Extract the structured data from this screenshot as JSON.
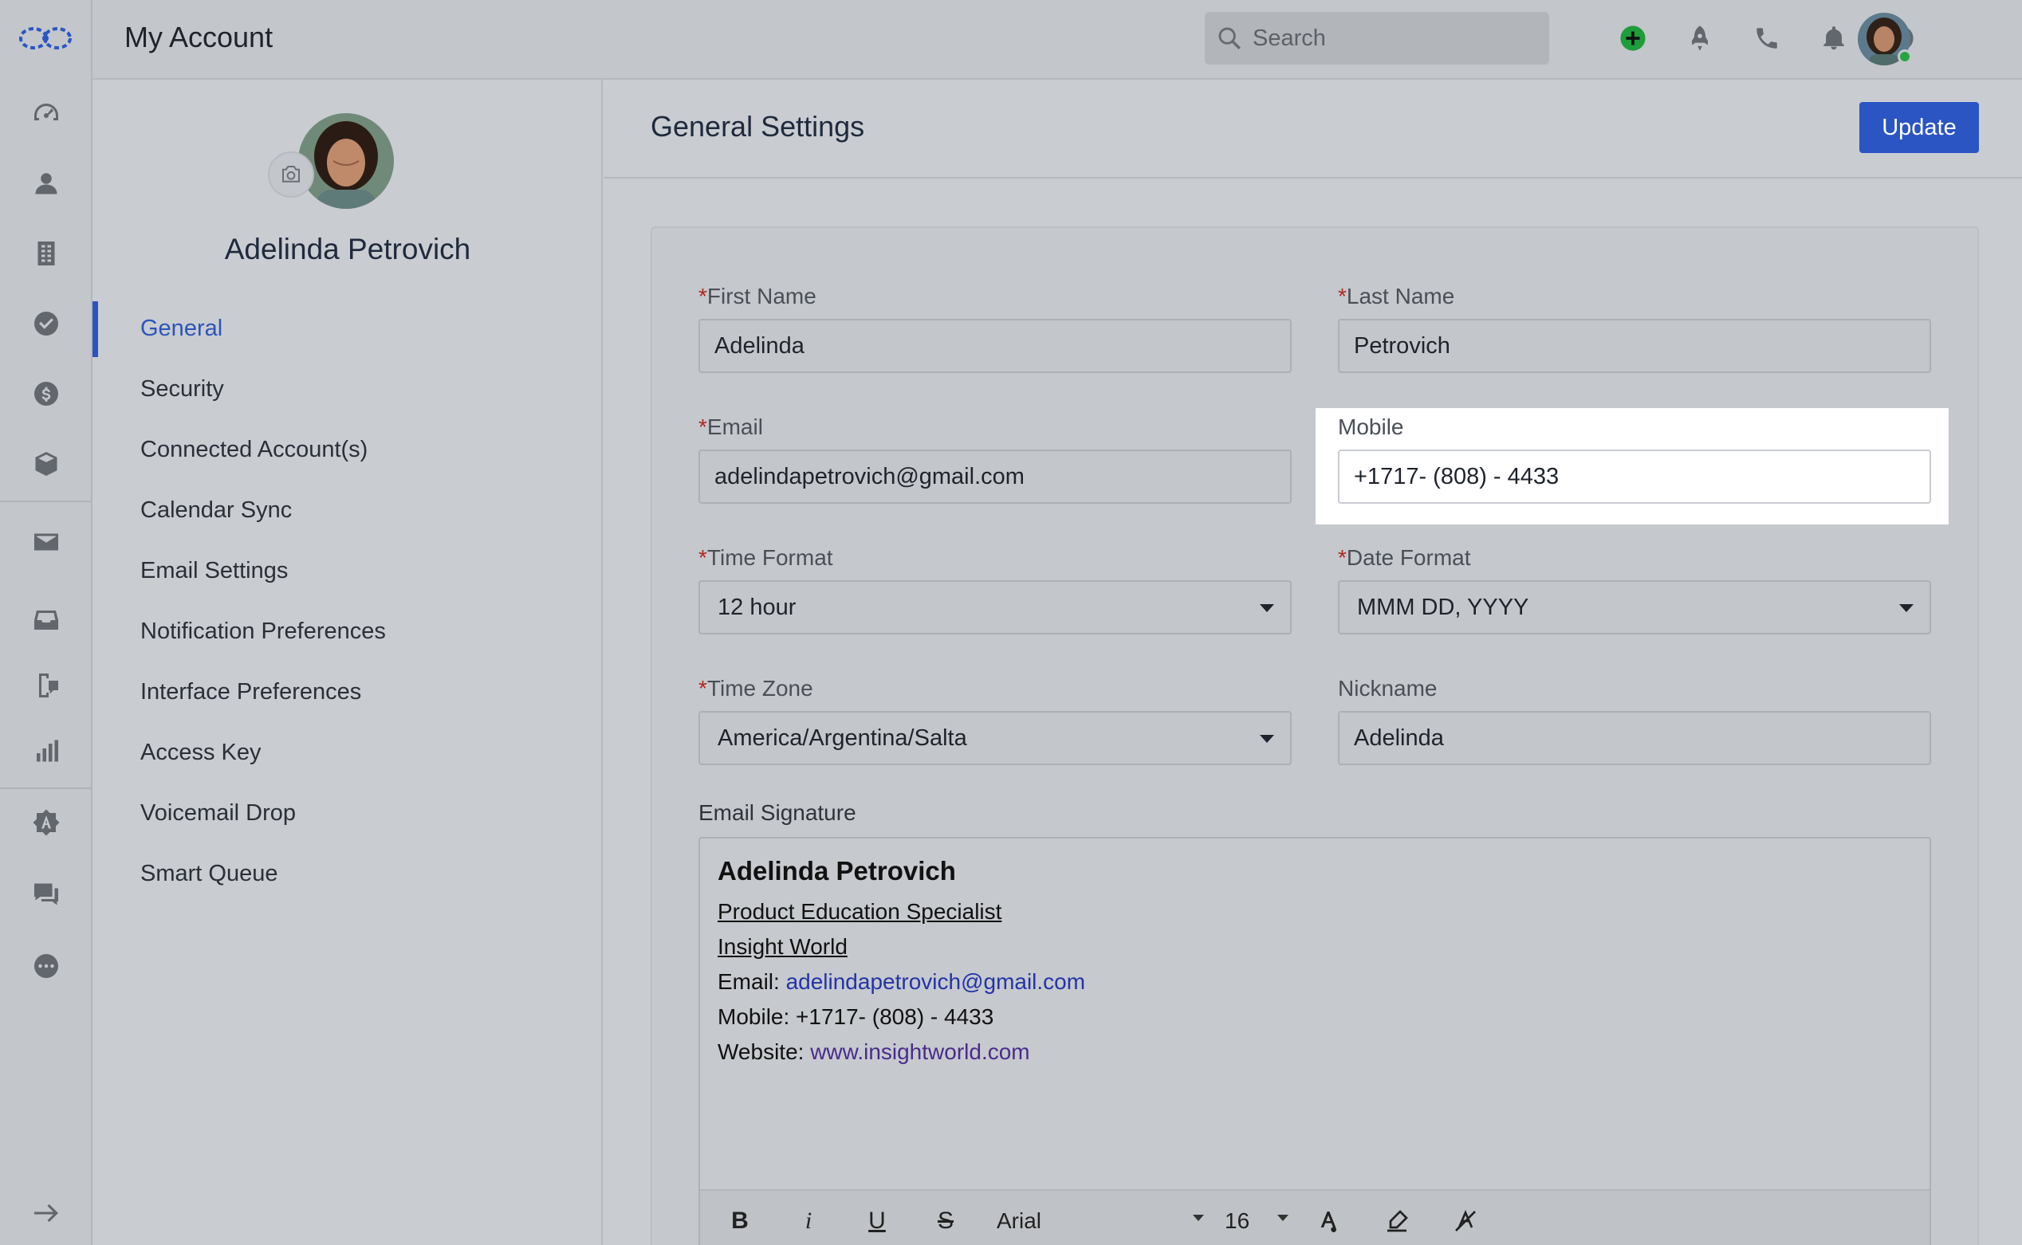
{
  "app": {
    "title": "My Account"
  },
  "search": {
    "placeholder": "Search"
  },
  "profile": {
    "name": "Adelinda Petrovich"
  },
  "menu": [
    {
      "label": "General",
      "active": true
    },
    {
      "label": "Security"
    },
    {
      "label": "Connected Account(s)"
    },
    {
      "label": "Calendar Sync"
    },
    {
      "label": "Email Settings"
    },
    {
      "label": "Notification Preferences"
    },
    {
      "label": "Interface Preferences"
    },
    {
      "label": "Access Key"
    },
    {
      "label": "Voicemail Drop"
    },
    {
      "label": "Smart Queue"
    }
  ],
  "content": {
    "heading": "General Settings",
    "update_label": "Update"
  },
  "form": {
    "first_name": {
      "label": "First Name",
      "value": "Adelinda",
      "required": "*"
    },
    "last_name": {
      "label": "Last Name",
      "value": "Petrovich",
      "required": "*"
    },
    "email": {
      "label": "Email",
      "value": "adelindapetrovich@gmail.com",
      "required": "*"
    },
    "mobile": {
      "label": "Mobile",
      "value": "+1717- (808) - 4433"
    },
    "time_format": {
      "label": "Time Format",
      "value": "12 hour",
      "required": "*"
    },
    "date_format": {
      "label": "Date Format",
      "value": "MMM DD, YYYY",
      "required": "*"
    },
    "time_zone": {
      "label": "Time Zone",
      "value": "America/Argentina/Salta",
      "required": "*"
    },
    "nickname": {
      "label": "Nickname",
      "value": "Adelinda"
    },
    "signature_label": "Email Signature"
  },
  "signature": {
    "name": "Adelinda Petrovich",
    "title": "Product Education Specialist",
    "company": "Insight World",
    "email_prefix": "Email: ",
    "email": "adelindapetrovich@gmail.com",
    "mobile": "Mobile: +1717- (808) - 4433",
    "website_prefix": "Website: ",
    "website": "www.insightworld.com"
  },
  "editor_toolbar": {
    "bold": "B",
    "italic": "i",
    "underline": "U",
    "strike": "S",
    "font": "Arial",
    "size": "16"
  },
  "colors": {
    "accent": "#2a55c3",
    "active_menu": "#2b55b8",
    "required": "#b3261e",
    "online": "#27a544",
    "add": "#1f9d3a"
  }
}
